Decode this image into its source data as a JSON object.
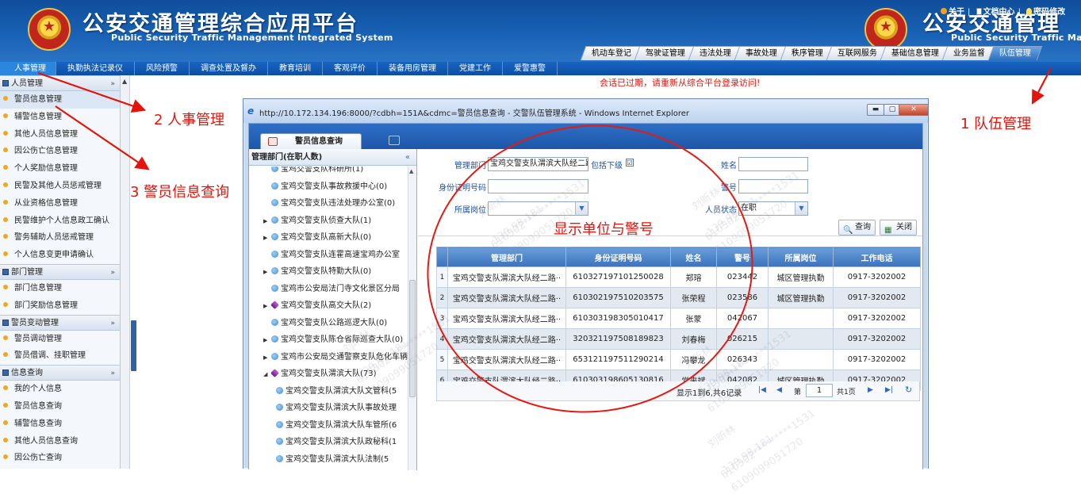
{
  "header": {
    "title_cn": "公安交通管理综合应用平台",
    "title_en": "Public Security Traffic Management Integrated System",
    "title_cn_dup": "公安交通管理",
    "title_en_dup": "Public Security Traffic Ma",
    "top_links": [
      "关于",
      "文档中心",
      "密码修改"
    ],
    "top_separator": "|"
  },
  "right_tabs": [
    "机动车登记",
    "驾驶证管理",
    "违法处理",
    "事故处理",
    "秩序管理",
    "互联网服务",
    "基础信息管理",
    "业务监督",
    "队伍管理"
  ],
  "right_tabs_active": 8,
  "menubar": {
    "items": [
      "人事管理",
      "执勤执法记录仪",
      "风险预警",
      "调查处置及督办",
      "教育培训",
      "客观评价",
      "装备用房管理",
      "党建工作",
      "爱警惠警"
    ],
    "active": 0
  },
  "session_message": "会话已过期，请重新从综合平台登录访问!",
  "sidebar": {
    "groups": [
      {
        "title": "人员管理",
        "items": [
          "警员信息管理",
          "辅警信息管理",
          "其他人员信息管理",
          "因公伤亡信息管理",
          "个人奖励信息管理",
          "民警及其他人员惩戒管理",
          "从业资格信息管理",
          "民警维护个人信息政工确认",
          "警务辅助人员惩戒管理",
          "个人信息变更申请确认"
        ]
      },
      {
        "title": "部门管理",
        "items": [
          "部门信息管理",
          "部门奖励信息管理"
        ]
      },
      {
        "title": "警员变动管理",
        "items": [
          "警员调动管理",
          "警员借调、挂职管理"
        ]
      },
      {
        "title": "信息查询",
        "items": [
          "我的个人信息",
          "警员信息查询",
          "辅警信息查询",
          "其他人员信息查询",
          "因公伤亡查询"
        ]
      }
    ],
    "chevron": "»"
  },
  "popup": {
    "title": "http://10.172.134.196:8000/?cdbh=151A&cdmc=警员信息查询 - 交警队伍管理系统 - Windows Internet Explorer",
    "tab_label": "警员信息查询",
    "tree": {
      "header": "管理部门(在职人数)",
      "collapse": "«",
      "nodes": [
        {
          "text": "宝鸡交警支队科研所(1)",
          "arrow": "",
          "indent": 0,
          "icon": "blue"
        },
        {
          "text": "宝鸡交警支队事故救援中心(0)",
          "arrow": "",
          "indent": 0,
          "icon": "blue"
        },
        {
          "text": "宝鸡交警支队违法处理办公室(0)",
          "arrow": "",
          "indent": 0,
          "icon": "blue"
        },
        {
          "text": "宝鸡交警支队侦查大队(1)",
          "arrow": "▶",
          "indent": 0,
          "icon": "blue"
        },
        {
          "text": "宝鸡交警支队高新大队(0)",
          "arrow": "▶",
          "indent": 0,
          "icon": "blue"
        },
        {
          "text": "宝鸡交警支队连霍高速宝鸡办公室",
          "arrow": "",
          "indent": 0,
          "icon": "blue"
        },
        {
          "text": "宝鸡交警支队特勤大队(0)",
          "arrow": "▶",
          "indent": 0,
          "icon": "blue"
        },
        {
          "text": "宝鸡市公安局法门寺文化景区分局",
          "arrow": "",
          "indent": 0,
          "icon": "blue"
        },
        {
          "text": "宝鸡交警支队高交大队(2)",
          "arrow": "▶",
          "indent": 0,
          "icon": "purple"
        },
        {
          "text": "宝鸡交警支队公路巡逻大队(0)",
          "arrow": "",
          "indent": 0,
          "icon": "blue"
        },
        {
          "text": "宝鸡交警支队陈仓省际巡查大队(0)",
          "arrow": "▶",
          "indent": 0,
          "icon": "blue"
        },
        {
          "text": "宝鸡市公安局交通警察支队危化车辆",
          "arrow": "▶",
          "indent": 0,
          "icon": "blue"
        },
        {
          "text": "宝鸡交警支队渭滨大队(73)",
          "arrow": "◢",
          "indent": 0,
          "icon": "purple"
        },
        {
          "text": "宝鸡交警支队渭滨大队文管科(5",
          "arrow": "",
          "indent": 1,
          "icon": "blue"
        },
        {
          "text": "宝鸡交警支队渭滨大队事故处理",
          "arrow": "",
          "indent": 1,
          "icon": "blue"
        },
        {
          "text": "宝鸡交警支队渭滨大队车管所(6",
          "arrow": "",
          "indent": 1,
          "icon": "blue"
        },
        {
          "text": "宝鸡交警支队渭滨大队政秘科(1",
          "arrow": "",
          "indent": 1,
          "icon": "blue"
        },
        {
          "text": "宝鸡交警支队渭滨大队法制(5",
          "arrow": "",
          "indent": 1,
          "icon": "blue"
        }
      ]
    },
    "form": {
      "dept_label": "管理部门",
      "dept_value": "宝鸡交警支队渭滨大队经二路",
      "include_sub_label": "包括下级",
      "include_sub_checked": "☑",
      "name_label": "姓名",
      "name_value": "",
      "id_label": "身份证明号码",
      "id_value": "",
      "badge_label": "警号",
      "badge_value": "",
      "post_label": "所属岗位",
      "post_value": "",
      "status_label": "人员状态",
      "status_value": "在职",
      "query_button": "查询",
      "close_button": "关闭"
    },
    "grid": {
      "columns": [
        "",
        "管理部门",
        "身份证明号码",
        "姓名",
        "警号",
        "所属岗位",
        "工作电话"
      ],
      "rows": [
        {
          "n": "1",
          "dept": "宝鸡交警支队渭滨大队经二路··",
          "id": "610327197101250028",
          "name": "郑瑢",
          "badge": "023442",
          "post": "城区管理执勤",
          "phone": "0917-3202002"
        },
        {
          "n": "2",
          "dept": "宝鸡交警支队渭滨大队经二路··",
          "id": "610302197510203575",
          "name": "张荣程",
          "badge": "023586",
          "post": "城区管理执勤",
          "phone": "0917-3202002"
        },
        {
          "n": "3",
          "dept": "宝鸡交警支队渭滨大队经二路··",
          "id": "610303198305010417",
          "name": "张蒙",
          "badge": "042067",
          "post": "",
          "phone": "0917-3202002"
        },
        {
          "n": "4",
          "dept": "宝鸡交警支队渭滨大队经二路··",
          "id": "320321197508189823",
          "name": "刘春梅",
          "badge": "026215",
          "post": "",
          "phone": "0917-3202002"
        },
        {
          "n": "5",
          "dept": "宝鸡交警支队渭滨大队经二路··",
          "id": "653121197511290214",
          "name": "冯攀龙",
          "badge": "026343",
          "post": "",
          "phone": "0917-3202002"
        },
        {
          "n": "6",
          "dept": "宝鸡交警支队渭滨大队经二路··",
          "id": "610303198605130816",
          "name": "常来斌",
          "badge": "042082",
          "post": "城区管理执勤",
          "phone": "0917-3202002"
        }
      ],
      "pager_info": "显示1到6,共6记录",
      "page_prefix": "第",
      "page_value": "1",
      "page_suffix": "共1页"
    }
  },
  "annotations": {
    "a1": "1 队伍管理",
    "a2": "2 人事管理",
    "a3": "3 警员信息查询",
    "center": "显示单位与警号",
    "color": "#e2140b"
  },
  "watermark": {
    "name": "刘昕林",
    "line1": "610302*********1531",
    "line2": "139.98.181",
    "line3": "6109099051720"
  }
}
